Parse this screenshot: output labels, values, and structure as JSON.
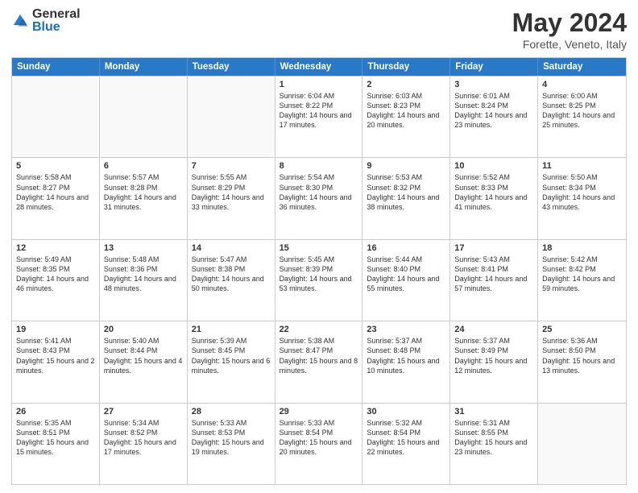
{
  "logo": {
    "general": "General",
    "blue": "Blue"
  },
  "header": {
    "title": "May 2024",
    "subtitle": "Forette, Veneto, Italy"
  },
  "days": [
    "Sunday",
    "Monday",
    "Tuesday",
    "Wednesday",
    "Thursday",
    "Friday",
    "Saturday"
  ],
  "weeks": [
    [
      {
        "day": "",
        "content": ""
      },
      {
        "day": "",
        "content": ""
      },
      {
        "day": "",
        "content": ""
      },
      {
        "day": "1",
        "content": "Sunrise: 6:04 AM\nSunset: 8:22 PM\nDaylight: 14 hours\nand 17 minutes."
      },
      {
        "day": "2",
        "content": "Sunrise: 6:03 AM\nSunset: 8:23 PM\nDaylight: 14 hours\nand 20 minutes."
      },
      {
        "day": "3",
        "content": "Sunrise: 6:01 AM\nSunset: 8:24 PM\nDaylight: 14 hours\nand 23 minutes."
      },
      {
        "day": "4",
        "content": "Sunrise: 6:00 AM\nSunset: 8:25 PM\nDaylight: 14 hours\nand 25 minutes."
      }
    ],
    [
      {
        "day": "5",
        "content": "Sunrise: 5:58 AM\nSunset: 8:27 PM\nDaylight: 14 hours\nand 28 minutes."
      },
      {
        "day": "6",
        "content": "Sunrise: 5:57 AM\nSunset: 8:28 PM\nDaylight: 14 hours\nand 31 minutes."
      },
      {
        "day": "7",
        "content": "Sunrise: 5:55 AM\nSunset: 8:29 PM\nDaylight: 14 hours\nand 33 minutes."
      },
      {
        "day": "8",
        "content": "Sunrise: 5:54 AM\nSunset: 8:30 PM\nDaylight: 14 hours\nand 36 minutes."
      },
      {
        "day": "9",
        "content": "Sunrise: 5:53 AM\nSunset: 8:32 PM\nDaylight: 14 hours\nand 38 minutes."
      },
      {
        "day": "10",
        "content": "Sunrise: 5:52 AM\nSunset: 8:33 PM\nDaylight: 14 hours\nand 41 minutes."
      },
      {
        "day": "11",
        "content": "Sunrise: 5:50 AM\nSunset: 8:34 PM\nDaylight: 14 hours\nand 43 minutes."
      }
    ],
    [
      {
        "day": "12",
        "content": "Sunrise: 5:49 AM\nSunset: 8:35 PM\nDaylight: 14 hours\nand 46 minutes."
      },
      {
        "day": "13",
        "content": "Sunrise: 5:48 AM\nSunset: 8:36 PM\nDaylight: 14 hours\nand 48 minutes."
      },
      {
        "day": "14",
        "content": "Sunrise: 5:47 AM\nSunset: 8:38 PM\nDaylight: 14 hours\nand 50 minutes."
      },
      {
        "day": "15",
        "content": "Sunrise: 5:45 AM\nSunset: 8:39 PM\nDaylight: 14 hours\nand 53 minutes."
      },
      {
        "day": "16",
        "content": "Sunrise: 5:44 AM\nSunset: 8:40 PM\nDaylight: 14 hours\nand 55 minutes."
      },
      {
        "day": "17",
        "content": "Sunrise: 5:43 AM\nSunset: 8:41 PM\nDaylight: 14 hours\nand 57 minutes."
      },
      {
        "day": "18",
        "content": "Sunrise: 5:42 AM\nSunset: 8:42 PM\nDaylight: 14 hours\nand 59 minutes."
      }
    ],
    [
      {
        "day": "19",
        "content": "Sunrise: 5:41 AM\nSunset: 8:43 PM\nDaylight: 15 hours\nand 2 minutes."
      },
      {
        "day": "20",
        "content": "Sunrise: 5:40 AM\nSunset: 8:44 PM\nDaylight: 15 hours\nand 4 minutes."
      },
      {
        "day": "21",
        "content": "Sunrise: 5:39 AM\nSunset: 8:45 PM\nDaylight: 15 hours\nand 6 minutes."
      },
      {
        "day": "22",
        "content": "Sunrise: 5:38 AM\nSunset: 8:47 PM\nDaylight: 15 hours\nand 8 minutes."
      },
      {
        "day": "23",
        "content": "Sunrise: 5:37 AM\nSunset: 8:48 PM\nDaylight: 15 hours\nand 10 minutes."
      },
      {
        "day": "24",
        "content": "Sunrise: 5:37 AM\nSunset: 8:49 PM\nDaylight: 15 hours\nand 12 minutes."
      },
      {
        "day": "25",
        "content": "Sunrise: 5:36 AM\nSunset: 8:50 PM\nDaylight: 15 hours\nand 13 minutes."
      }
    ],
    [
      {
        "day": "26",
        "content": "Sunrise: 5:35 AM\nSunset: 8:51 PM\nDaylight: 15 hours\nand 15 minutes."
      },
      {
        "day": "27",
        "content": "Sunrise: 5:34 AM\nSunset: 8:52 PM\nDaylight: 15 hours\nand 17 minutes."
      },
      {
        "day": "28",
        "content": "Sunrise: 5:33 AM\nSunset: 8:53 PM\nDaylight: 15 hours\nand 19 minutes."
      },
      {
        "day": "29",
        "content": "Sunrise: 5:33 AM\nSunset: 8:54 PM\nDaylight: 15 hours\nand 20 minutes."
      },
      {
        "day": "30",
        "content": "Sunrise: 5:32 AM\nSunset: 8:54 PM\nDaylight: 15 hours\nand 22 minutes."
      },
      {
        "day": "31",
        "content": "Sunrise: 5:31 AM\nSunset: 8:55 PM\nDaylight: 15 hours\nand 23 minutes."
      },
      {
        "day": "",
        "content": ""
      }
    ]
  ]
}
